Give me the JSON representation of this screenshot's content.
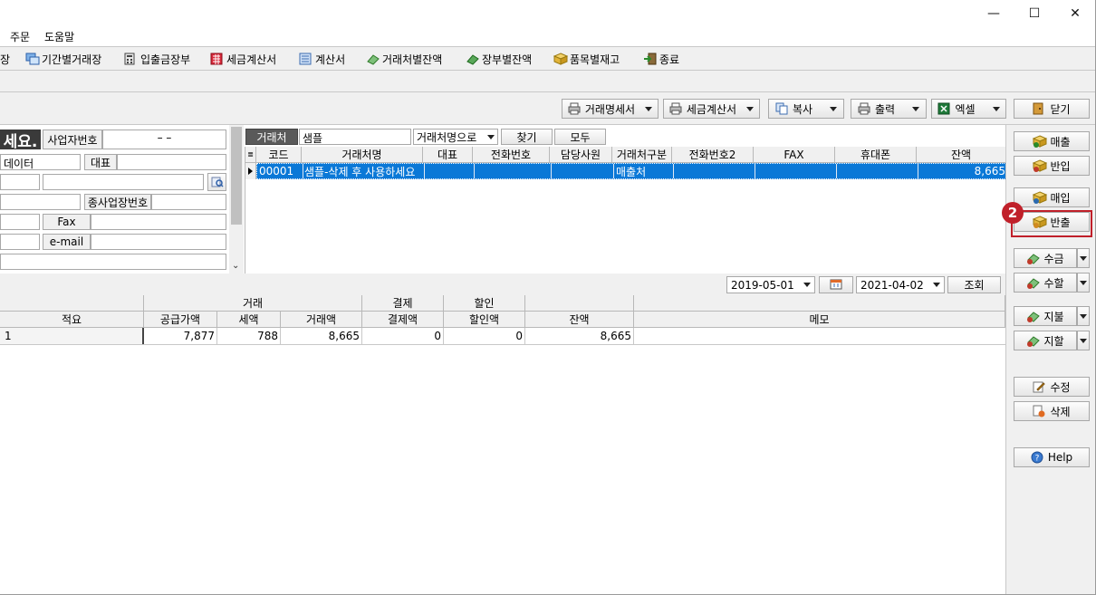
{
  "window": {
    "minimize": "—",
    "maximize": "☐",
    "close": "✕"
  },
  "menu": [
    "주문",
    "도움말"
  ],
  "toolbar": [
    {
      "label": "장",
      "icon": "ledger-icon"
    },
    {
      "label": "기간별거래장",
      "icon": "period-ledger-icon"
    },
    {
      "label": "입출금장부",
      "icon": "cashbook-icon"
    },
    {
      "label": "세금계산서",
      "icon": "tax-invoice-icon"
    },
    {
      "label": "계산서",
      "icon": "invoice-icon"
    },
    {
      "label": "거래처별잔액",
      "icon": "client-balance-icon"
    },
    {
      "label": "장부별잔액",
      "icon": "book-balance-icon"
    },
    {
      "label": "품목별재고",
      "icon": "item-stock-icon"
    },
    {
      "label": "종료",
      "icon": "exit-icon"
    }
  ],
  "actions": {
    "statement": "거래명세서",
    "tax_invoice": "세금계산서",
    "copy": "복사",
    "print": "출력",
    "excel": "엑셀",
    "close": "닫기"
  },
  "form": {
    "title_fragment": "세요.",
    "biz_no_label": "사업자번호",
    "biz_no_value": "–    –",
    "data_value": "데이터",
    "rep_label": "대표",
    "sub_biz_label": "종사업장번호",
    "fax_label": "Fax",
    "email_label": "e-mail"
  },
  "search": {
    "client_label": "거래처",
    "query": "샘플",
    "mode": "거래처명으로",
    "find": "찾기",
    "all": "모두"
  },
  "client_grid": {
    "headers": [
      "코드",
      "거래처명",
      "대표",
      "전화번호",
      "담당사원",
      "거래처구분",
      "전화번호2",
      "FAX",
      "휴대폰",
      "잔액"
    ],
    "rows": [
      {
        "code": "00001",
        "name": "샘플-삭제 후 사용하세요",
        "rep": "",
        "phone": "",
        "staff": "",
        "type": "매출처",
        "phone2": "",
        "fax": "",
        "mobile": "",
        "balance": "8,665"
      }
    ]
  },
  "period": {
    "from": "2019-05-01",
    "to": "2021-04-02",
    "query": "조회"
  },
  "ledger": {
    "group_trade": "거래",
    "group_pay": "결제",
    "group_discount": "할인",
    "headers": [
      "적요",
      "공급가액",
      "세액",
      "거래액",
      "결제액",
      "할인액",
      "잔액",
      "메모"
    ],
    "rows": [
      {
        "memo_text": "1",
        "supply": "7,877",
        "tax": "788",
        "total": "8,665",
        "paid": "0",
        "discount": "0",
        "balance": "8,665",
        "memo": ""
      }
    ]
  },
  "side_buttons": {
    "sales": "매출",
    "sales_return": "반입",
    "purchase": "매입",
    "purchase_return": "반출",
    "receive": "수금",
    "receive_discount": "수할",
    "pay": "지불",
    "pay_discount": "지할",
    "edit": "수정",
    "delete": "삭제",
    "help": "Help"
  },
  "annotation": {
    "step": "2",
    "color": "#c0202a"
  }
}
